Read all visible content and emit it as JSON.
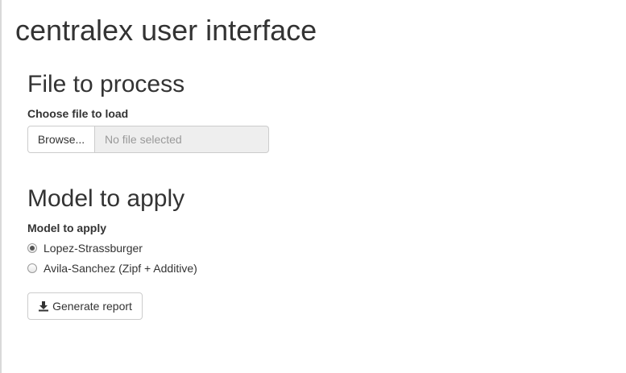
{
  "page": {
    "title": "centralex user interface"
  },
  "file_section": {
    "heading": "File to process",
    "label": "Choose file to load",
    "browse_label": "Browse...",
    "file_placeholder": "No file selected"
  },
  "model_section": {
    "heading": "Model to apply",
    "label": "Model to apply",
    "options": [
      {
        "label": "Lopez-Strassburger",
        "selected": true
      },
      {
        "label": "Avila-Sanchez (Zipf + Additive)",
        "selected": false
      }
    ]
  },
  "actions": {
    "generate_label": "Generate report",
    "generate_icon": "download-icon"
  }
}
